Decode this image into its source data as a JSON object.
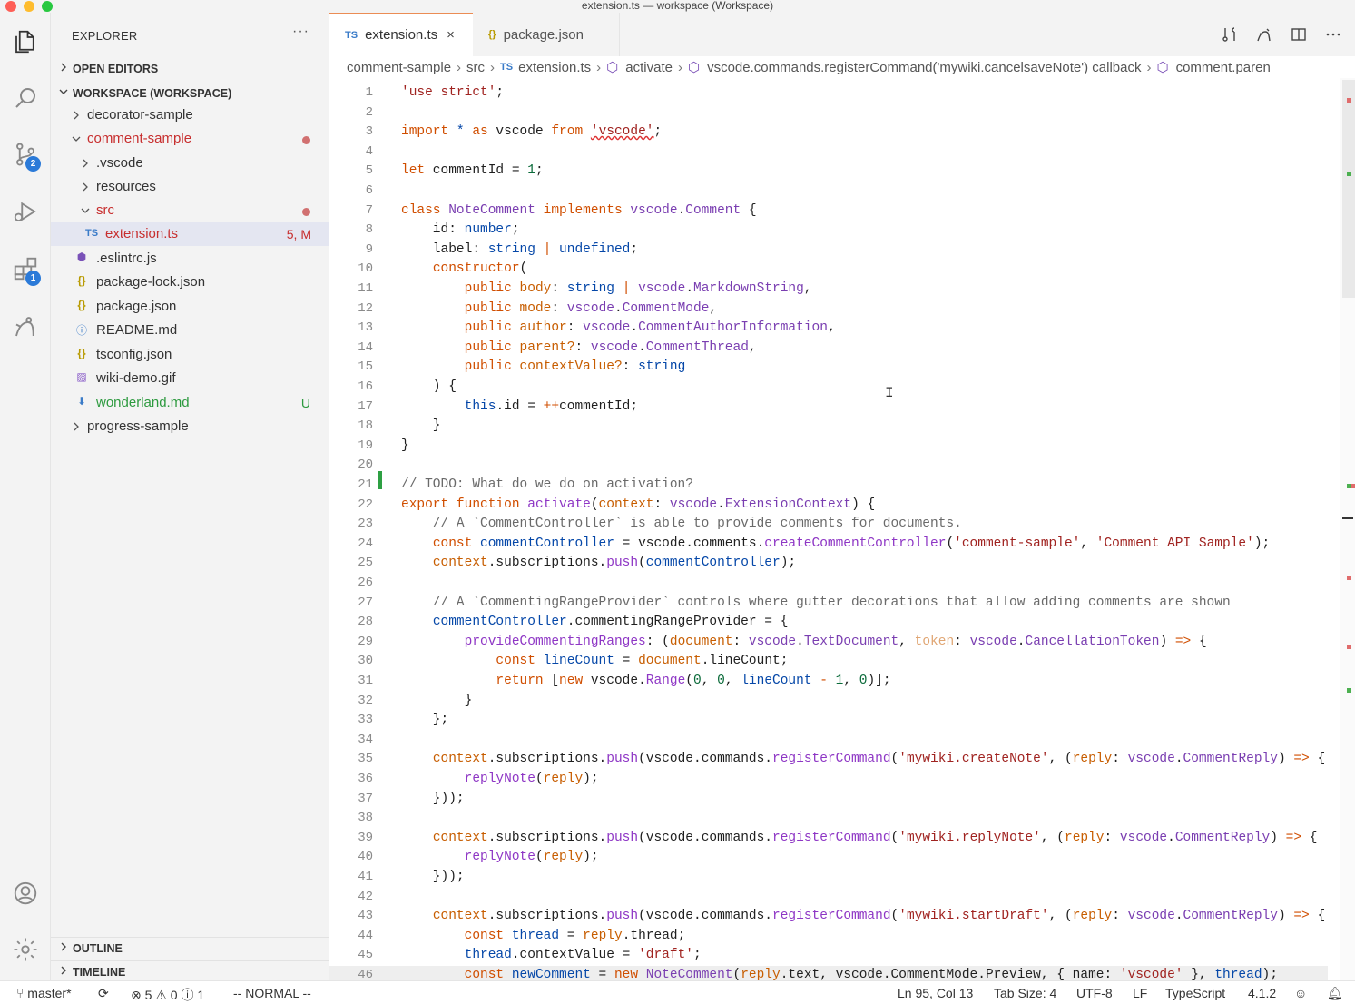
{
  "window": {
    "title": "extension.ts — workspace (Workspace)"
  },
  "activity": {
    "scm_badge": "2",
    "extensions_badge": "1"
  },
  "sidebar": {
    "title": "EXPLORER",
    "more": "···",
    "open_editors": "OPEN EDITORS",
    "workspace": "WORKSPACE (WORKSPACE)",
    "outline": "OUTLINE",
    "timeline": "TIMELINE",
    "tree": [
      {
        "name": "decorator-sample",
        "icon": "",
        "deco": ""
      },
      {
        "name": "comment-sample",
        "icon": "",
        "deco": ""
      },
      {
        "name": ".vscode",
        "icon": "",
        "deco": ""
      },
      {
        "name": "resources",
        "icon": "",
        "deco": ""
      },
      {
        "name": "src",
        "icon": "",
        "deco": ""
      },
      {
        "name": "extension.ts",
        "icon": "TS",
        "deco": "5, M"
      },
      {
        "name": ".eslintrc.js",
        "icon": "⬢",
        "deco": ""
      },
      {
        "name": "package-lock.json",
        "icon": "{}",
        "deco": ""
      },
      {
        "name": "package.json",
        "icon": "{}",
        "deco": ""
      },
      {
        "name": "README.md",
        "icon": "ⓘ",
        "deco": ""
      },
      {
        "name": "tsconfig.json",
        "icon": "{}",
        "deco": ""
      },
      {
        "name": "wiki-demo.gif",
        "icon": "▨",
        "deco": ""
      },
      {
        "name": "wonderland.md",
        "icon": "⬇",
        "deco": "U"
      },
      {
        "name": "progress-sample",
        "icon": "",
        "deco": ""
      }
    ]
  },
  "tabs": [
    {
      "label": "extension.ts",
      "icon": "TS",
      "close": "×"
    },
    {
      "label": "package.json",
      "icon": "{}"
    }
  ],
  "breadcrumb": {
    "items": [
      "comment-sample",
      "src",
      "extension.ts",
      "activate",
      "vscode.commands.registerCommand('mywiki.cancelsaveNote') callback",
      "comment.paren"
    ],
    "ts_icon": "TS"
  },
  "code": {
    "line_numbers": [
      "1",
      "2",
      "3",
      "4",
      "5",
      "6",
      "7",
      "8",
      "9",
      "10",
      "11",
      "12",
      "13",
      "14",
      "15",
      "16",
      "17",
      "18",
      "19",
      "20",
      "21",
      "22",
      "23",
      "24",
      "25",
      "26",
      "27",
      "28",
      "29",
      "30",
      "31",
      "32",
      "33",
      "34",
      "35",
      "36",
      "37",
      "38",
      "39",
      "40",
      "41",
      "42",
      "43",
      "44",
      "45",
      "46"
    ]
  },
  "status": {
    "branch": "master*",
    "errors": "5",
    "warnings": "0",
    "infos": "1",
    "mode": "-- NORMAL --",
    "position": "Ln 95, Col 13",
    "tab_size": "Tab Size: 4",
    "encoding": "UTF-8",
    "eol": "LF",
    "language": "TypeScript",
    "version": "4.1.2"
  }
}
